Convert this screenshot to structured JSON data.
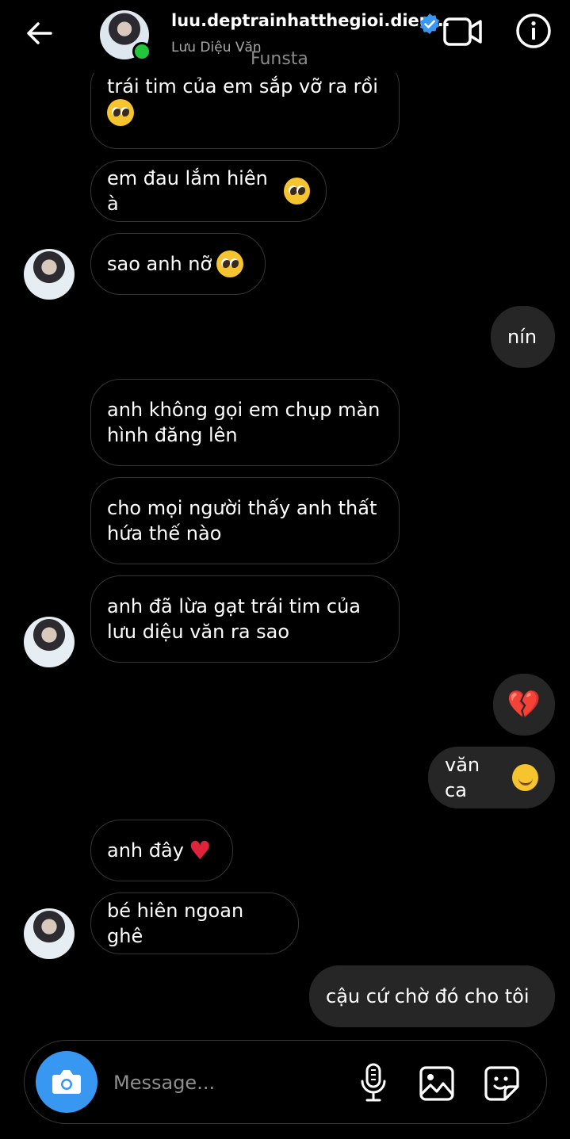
{
  "header": {
    "username": "luu.deptrainhatthegioi.dieu...",
    "real_name": "Lưu Diệu Văn",
    "watermark": "Funsta"
  },
  "messages": [
    {
      "side": "received",
      "text": "trái tim của em sắp vỡ ra rồi",
      "emoji": "pleading-face"
    },
    {
      "side": "received",
      "text": "em đau lắm hiên à",
      "emoji": "pleading-face"
    },
    {
      "side": "received",
      "text": "sao anh nỡ",
      "emoji": "pleading-face"
    },
    {
      "side": "sent",
      "text": "nín"
    },
    {
      "side": "received",
      "text": "anh không gọi em chụp màn hình đăng lên"
    },
    {
      "side": "received",
      "text": "cho mọi người thấy anh thất hứa thế nào"
    },
    {
      "side": "received",
      "text": "anh đã lừa gạt trái tim của lưu diệu văn ra sao"
    },
    {
      "side": "sent",
      "text": "",
      "emoji": "broken-heart"
    },
    {
      "side": "sent",
      "text": "văn ca",
      "emoji": "smiling-face"
    },
    {
      "side": "received",
      "text": "anh đây",
      "emoji": "red-heart"
    },
    {
      "side": "received",
      "text": "bé hiên ngoan ghê"
    },
    {
      "side": "sent",
      "text": "cậu cứ chờ đó cho tôi"
    }
  ],
  "composer": {
    "placeholder": "Message..."
  },
  "colors": {
    "accent": "#3897f0",
    "online": "#23c53c",
    "sent_bubble": "#262626",
    "bubble_border": "#363636"
  }
}
